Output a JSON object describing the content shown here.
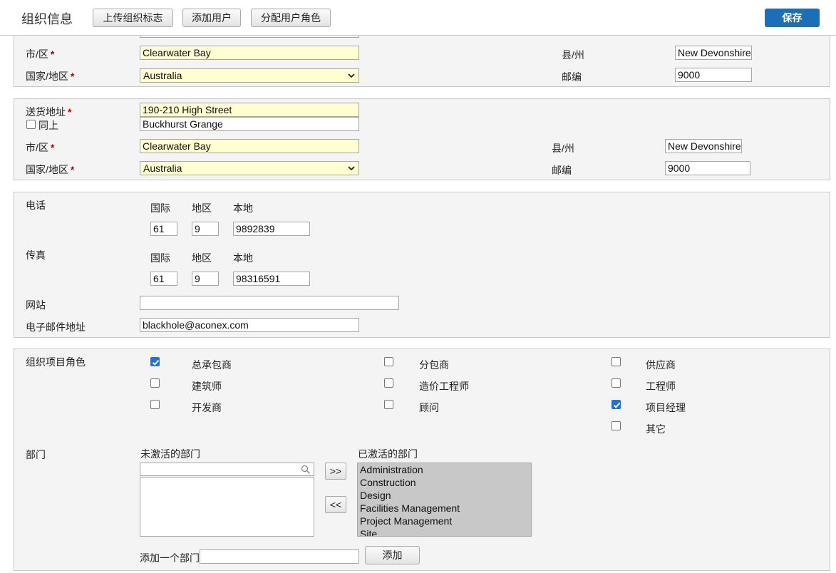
{
  "header": {
    "title": "组织信息",
    "buttons": [
      "上传组织标志",
      "添加用户",
      "分配用户角色"
    ],
    "save_label": "保存"
  },
  "postal": {
    "city_label": "市/区",
    "city_value": "Clearwater Bay",
    "country_label": "国家/地区",
    "country_value": "Australia",
    "state_label": "县/州",
    "state_value": "New Devonshire",
    "postcode_label": "邮编",
    "postcode_value": "9000"
  },
  "delivery": {
    "address_label": "送货地址",
    "line1": "190-210 High Street",
    "line2": "Buckhurst Grange",
    "same_label": "同上",
    "same_checked": false,
    "city_label": "市/区",
    "city_value": "Clearwater Bay",
    "country_label": "国家/地区",
    "country_value": "Australia",
    "state_label": "县/州",
    "state_value": "New Devonshire",
    "postcode_label": "邮编",
    "postcode_value": "9000"
  },
  "contact": {
    "phone_label": "电话",
    "fax_label": "传真",
    "intl_label": "国际",
    "area_label": "地区",
    "local_label": "本地",
    "phone": {
      "intl": "61",
      "area": "9",
      "local": "9892839"
    },
    "fax": {
      "intl": "61",
      "area": "9",
      "local": "98316591"
    },
    "website_label": "网站",
    "website_value": "",
    "email_label": "电子邮件地址",
    "email_value": "blackhole@aconex.com"
  },
  "roles": {
    "label": "组织项目角色",
    "items": [
      {
        "label": "总承包商",
        "checked": true
      },
      {
        "label": "分包商",
        "checked": false
      },
      {
        "label": "供应商",
        "checked": false
      },
      {
        "label": "建筑师",
        "checked": false
      },
      {
        "label": "造价工程师",
        "checked": false
      },
      {
        "label": "工程师",
        "checked": false
      },
      {
        "label": "开发商",
        "checked": false
      },
      {
        "label": "顾问",
        "checked": false
      },
      {
        "label": "项目经理",
        "checked": true
      },
      {
        "label": "其它",
        "checked": false
      }
    ]
  },
  "departments": {
    "label": "部门",
    "inactive_label": "未激活的部门",
    "active_label": "已激活的部门",
    "search_value": "",
    "inactive_items": [],
    "active_items": [
      "Administration",
      "Construction",
      "Design",
      "Facilities Management",
      "Project Management",
      "Site"
    ],
    "move_right_label": ">>",
    "move_left_label": "<<",
    "add_label": "添加一个部门",
    "add_value": "",
    "add_button_label": "添加"
  },
  "colors": {
    "accent": "#1a6fb8",
    "required": "#c00000",
    "highlight_field": "#ffffd2",
    "panel": "#f4f4f4"
  },
  "icons": [
    "search-icon",
    "chevron-down-icon",
    "checkmark-icon"
  ]
}
